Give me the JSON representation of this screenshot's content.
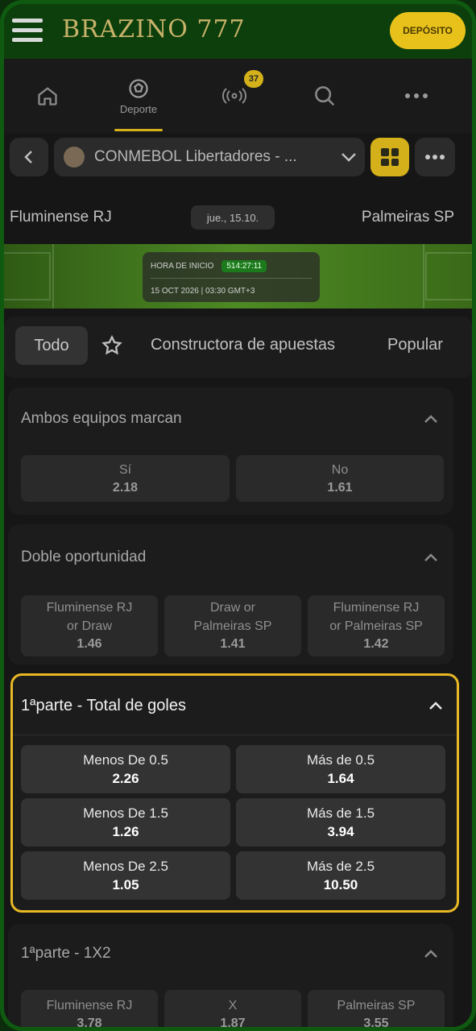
{
  "header": {
    "brand": "BRAZINO 777",
    "deposit_label": "DEPÓSITO"
  },
  "nav": {
    "items": [
      {
        "icon": "home-icon",
        "label": ""
      },
      {
        "icon": "soccer-ball-icon",
        "label": "Deporte"
      },
      {
        "icon": "live-broadcast-icon",
        "label": "",
        "badge": "37"
      },
      {
        "icon": "search-icon",
        "label": ""
      },
      {
        "icon": "more-icon",
        "label": ""
      }
    ]
  },
  "league": {
    "name": "CONMEBOL Libertadores - ..."
  },
  "match": {
    "home": "Fluminense RJ",
    "date": "jue., 15.10.",
    "away": "Palmeiras SP",
    "start_label": "HORA DE INICIO",
    "countdown": "514:27:11",
    "datetime": "15 OCT 2026 | 03:30 GMT+3"
  },
  "tabs": {
    "all": "Todo",
    "builder": "Constructora de apuestas",
    "popular": "Popular"
  },
  "markets": {
    "btts": {
      "title": "Ambos equipos marcan",
      "odds": [
        {
          "label": "Sí",
          "value": "2.18"
        },
        {
          "label": "No",
          "value": "1.61"
        }
      ]
    },
    "double_chance": {
      "title": "Doble oportunidad",
      "odds": [
        {
          "label1": "Fluminense RJ",
          "label2": "or Draw",
          "value": "1.46"
        },
        {
          "label1": "Draw or",
          "label2": "Palmeiras SP",
          "value": "1.41"
        },
        {
          "label1": "Fluminense RJ",
          "label2": "or Palmeiras SP",
          "value": "1.42"
        }
      ]
    },
    "first_half_total": {
      "title": "1ªparte - Total de goles",
      "odds": [
        {
          "label": "Menos De 0.5",
          "value": "2.26"
        },
        {
          "label": "Más de 0.5",
          "value": "1.64"
        },
        {
          "label": "Menos De 1.5",
          "value": "1.26"
        },
        {
          "label": "Más de 1.5",
          "value": "3.94"
        },
        {
          "label": "Menos De 2.5",
          "value": "1.05"
        },
        {
          "label": "Más de 2.5",
          "value": "10.50"
        }
      ]
    },
    "first_half_1x2": {
      "title": "1ªparte - 1X2",
      "odds": [
        {
          "label": "Fluminense RJ",
          "value": "3.78"
        },
        {
          "label": "X",
          "value": "1.87"
        },
        {
          "label": "Palmeiras SP",
          "value": "3.55"
        }
      ]
    }
  },
  "colors": {
    "accent": "#d4b11a",
    "highlight_border": "#e8b825",
    "frame": "#0f5a10"
  }
}
